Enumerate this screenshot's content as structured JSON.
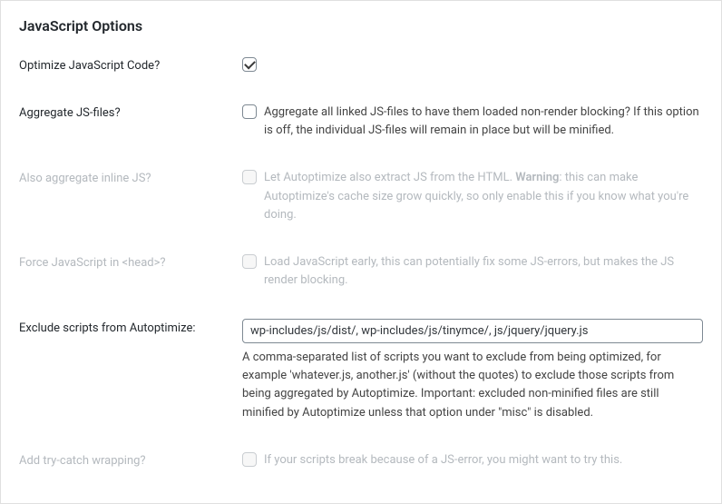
{
  "panel": {
    "title": "JavaScript Options"
  },
  "rows": {
    "optimize": {
      "label": "Optimize JavaScript Code?"
    },
    "aggregate": {
      "label": "Aggregate JS-files?",
      "description": "Aggregate all linked JS-files to have them loaded non-render blocking? If this option is off, the individual JS-files will remain in place but will be minified."
    },
    "inline": {
      "label": "Also aggregate inline JS?",
      "desc_before": "Let Autoptimize also extract JS from the HTML. ",
      "desc_warning": "Warning",
      "desc_after": ": this can make Autoptimize's cache size grow quickly, so only enable this if you know what you're doing."
    },
    "forcehead": {
      "label": "Force JavaScript in <head>?",
      "description": "Load JavaScript early, this can potentially fix some JS-errors, but makes the JS render blocking."
    },
    "exclude": {
      "label": "Exclude scripts from Autoptimize:",
      "value": "wp-includes/js/dist/, wp-includes/js/tinymce/, js/jquery/jquery.js",
      "description": "A comma-separated list of scripts you want to exclude from being optimized, for example 'whatever.js, another.js' (without the quotes) to exclude those scripts from being aggregated by Autoptimize. Important: excluded non-minified files are still minified by Autoptimize unless that option under \"misc\" is disabled."
    },
    "trycatch": {
      "label": "Add try-catch wrapping?",
      "description": "If your scripts break because of a JS-error, you might want to try this."
    }
  }
}
